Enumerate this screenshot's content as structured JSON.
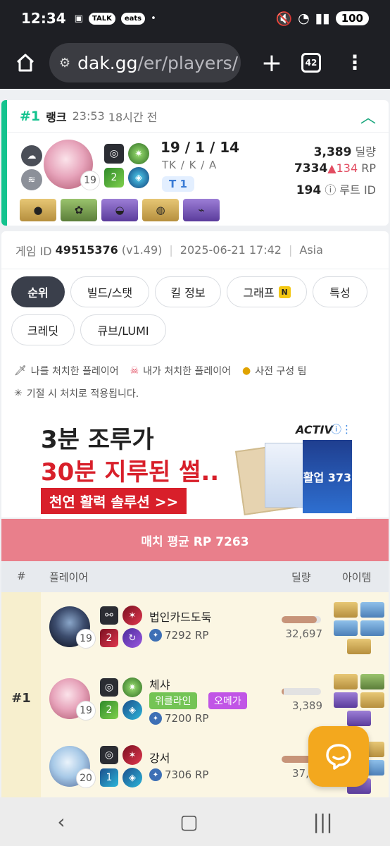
{
  "statusbar": {
    "time": "12:34",
    "notif_talk": "TALK",
    "notif_eats": "eats",
    "battery": "100"
  },
  "browser": {
    "url_domain": "dak.gg",
    "url_path": "/er/players/",
    "tab_count": "42"
  },
  "summary": {
    "rank": "#1",
    "rank_label": "랭크",
    "time": "23:53",
    "ago": "18시간 전",
    "kda": "19 / 1 / 14",
    "kda_label": "TK / K / A",
    "tier_tag": "T 1",
    "level": "19",
    "skill_level": "2",
    "damage": "3,389",
    "damage_label": "딜량",
    "rp": "7334",
    "rp_delta": "▲134",
    "rp_label": "RP",
    "route": "194",
    "route_label": "루트 ID"
  },
  "game_info": {
    "label": "게임 ID",
    "id": "49515376",
    "version": "(v1.49)",
    "datetime": "2025-06-21 17:42",
    "region": "Asia"
  },
  "tabs": [
    {
      "label": "순위"
    },
    {
      "label": "빌드/스탯"
    },
    {
      "label": "킬 정보"
    },
    {
      "label": "그래프",
      "badge": "N"
    },
    {
      "label": "특성"
    },
    {
      "label": "크레딧"
    },
    {
      "label": "큐브/LUMI"
    }
  ],
  "legend": {
    "killed_me": "나를 처치한 플레이어",
    "i_killed": "내가 처치한 플레이어",
    "premade": "사전 구성 팀",
    "note": "기절 시 처치로 적용됩니다."
  },
  "ad": {
    "line1": "3분 조루가",
    "line2": "30분 지루된 썰..",
    "button": "천연 활력 솔루션 >>",
    "brand": "ACTIV",
    "product": "활업 373"
  },
  "match_avg": "매치 평균 RP 7263",
  "table_head": {
    "hash": "#",
    "player": "플레이어",
    "damage": "딜량",
    "items": "아이템"
  },
  "team": {
    "rank": "#1",
    "players": [
      {
        "name": "법인카드도둑",
        "level": "19",
        "skill_level": "2",
        "rp": "7292 RP",
        "damage": "32,697",
        "damage_ratio": 0.9
      },
      {
        "name": "체샤",
        "level": "19",
        "skill_level": "2",
        "rp": "7200 RP",
        "damage": "3,389",
        "damage_ratio": 0.06,
        "tag1": "위클라인",
        "tag2": "오메가"
      },
      {
        "name": "강서",
        "level": "20",
        "skill_level": "1",
        "rp": "7306 RP",
        "damage": "37,07",
        "damage_ratio": 0.92
      }
    ]
  },
  "colors": {
    "accent": "#14c38e",
    "avg_bar": "#e97f8b",
    "fab": "#f3a81e"
  }
}
